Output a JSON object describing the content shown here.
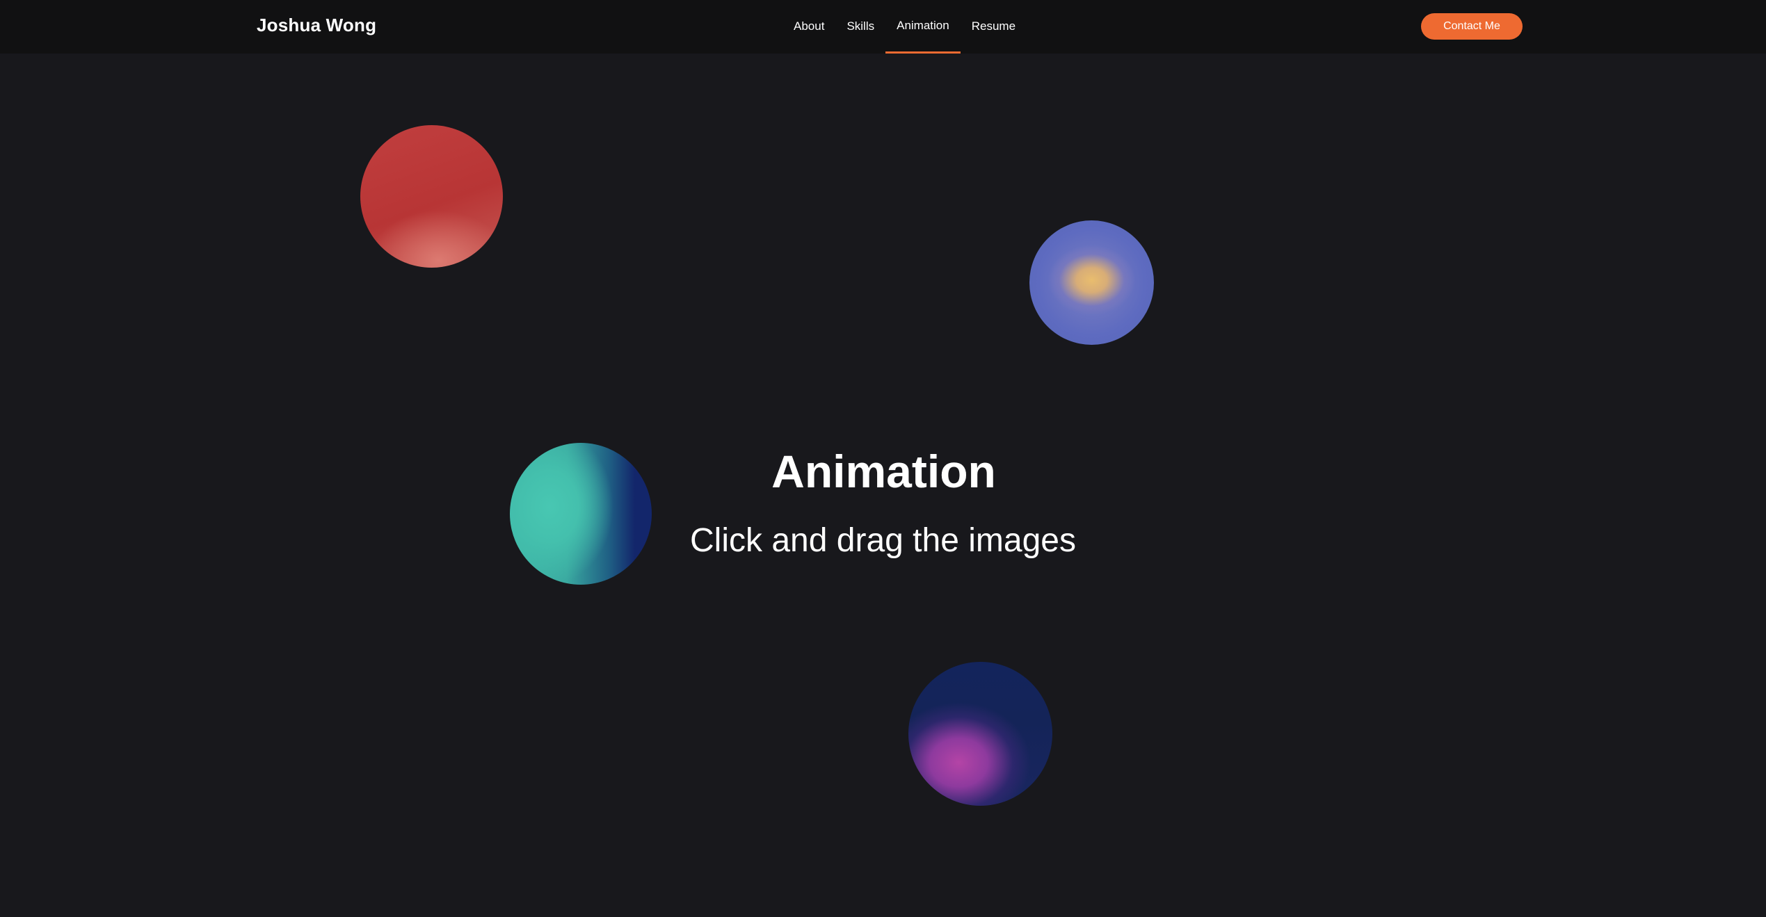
{
  "header": {
    "brand": "Joshua Wong",
    "nav": [
      {
        "label": "About",
        "active": false
      },
      {
        "label": "Skills",
        "active": false
      },
      {
        "label": "Animation",
        "active": true
      },
      {
        "label": "Resume",
        "active": false
      }
    ],
    "contact_label": "Contact Me"
  },
  "hero": {
    "title": "Animation",
    "subtitle": "Click and drag the images"
  },
  "images": [
    {
      "name": "red-orb"
    },
    {
      "name": "blue-gold-orb"
    },
    {
      "name": "teal-navy-orb"
    },
    {
      "name": "magenta-navy-orb"
    }
  ],
  "colors": {
    "accent": "#ee6a31",
    "background": "#18181c",
    "header_background": "#111112",
    "text": "#ffffff"
  }
}
